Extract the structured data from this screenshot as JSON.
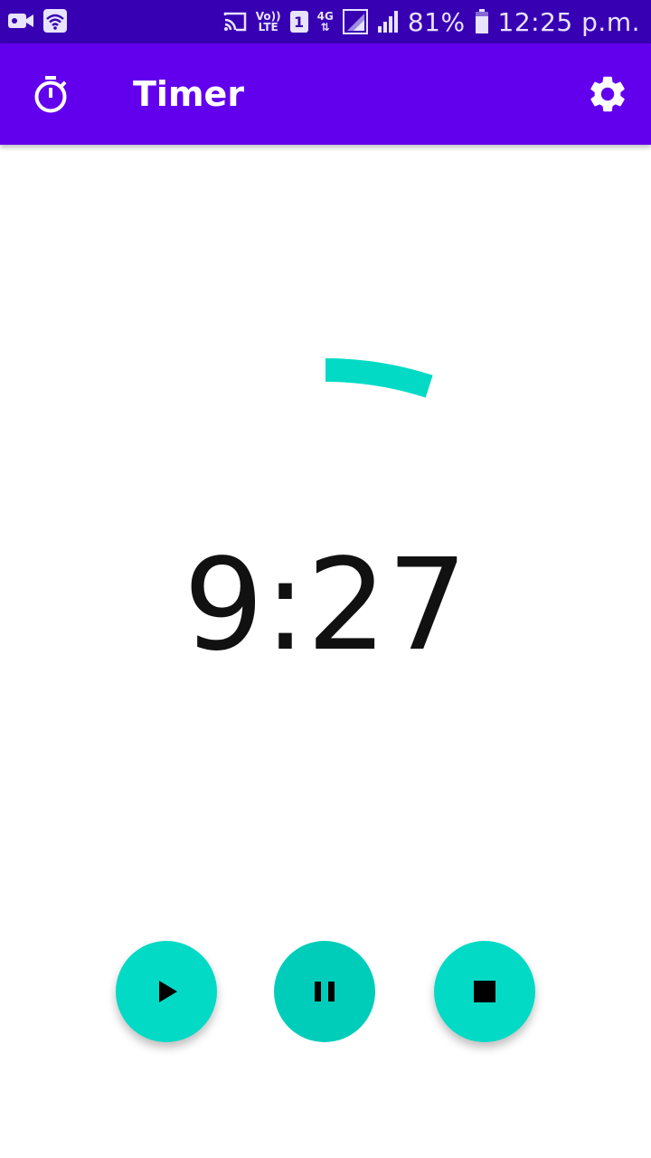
{
  "status_bar": {
    "volte_top": "Vo))",
    "volte_bottom": "LTE",
    "sim_slot": "1",
    "network_type": "4G",
    "battery": "81%",
    "time": "12:25 p.m."
  },
  "app_bar": {
    "title": "Timer",
    "left_icon": "timer-icon",
    "right_icon": "gear-icon"
  },
  "timer": {
    "display": "9:27",
    "progress_fraction": 0.05,
    "accent_color": "#03dac5"
  },
  "controls": {
    "play_icon": "play-icon",
    "pause_icon": "pause-icon",
    "stop_icon": "stop-icon"
  },
  "colors": {
    "status_bar": "#3700b3",
    "app_bar": "#6200ee",
    "accent": "#03dac5"
  }
}
